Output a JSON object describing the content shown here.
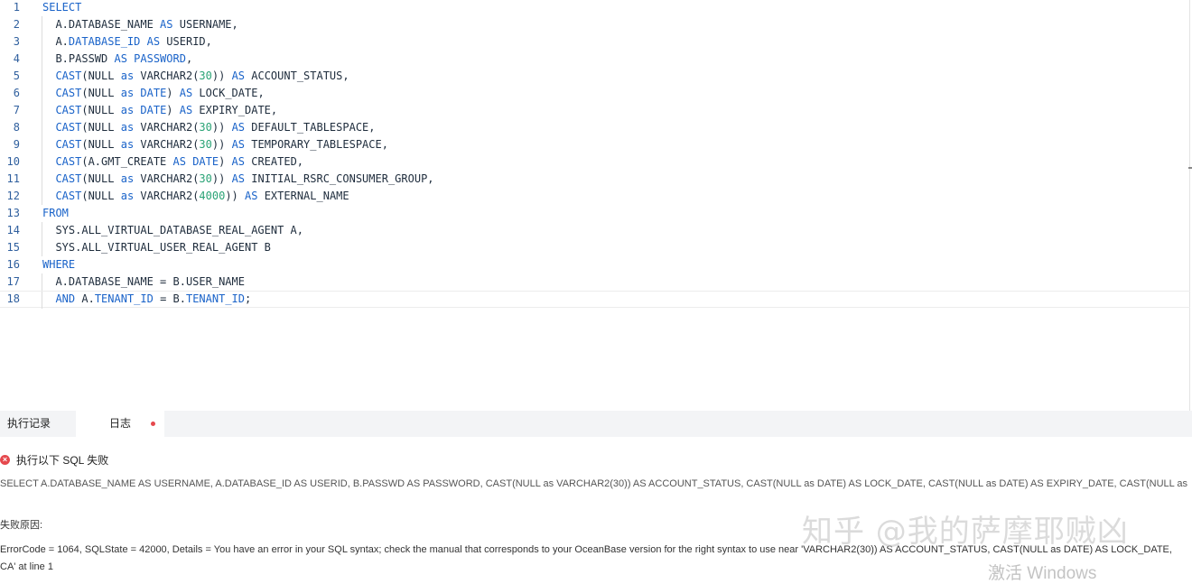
{
  "editor": {
    "lines": [
      [
        {
          "t": "SELECT",
          "c": "kw"
        }
      ],
      [
        {
          "t": "  A.DATABASE_NAME ",
          "c": "plain"
        },
        {
          "t": "AS",
          "c": "kw"
        },
        {
          "t": " USERNAME,",
          "c": "plain"
        }
      ],
      [
        {
          "t": "  A.",
          "c": "plain"
        },
        {
          "t": "DATABASE_ID",
          "c": "kw"
        },
        {
          "t": " ",
          "c": "plain"
        },
        {
          "t": "AS",
          "c": "kw"
        },
        {
          "t": " USERID,",
          "c": "plain"
        }
      ],
      [
        {
          "t": "  B.PASSWD ",
          "c": "plain"
        },
        {
          "t": "AS PASSWORD",
          "c": "kw"
        },
        {
          "t": ",",
          "c": "plain"
        }
      ],
      [
        {
          "t": "  ",
          "c": "plain"
        },
        {
          "t": "CAST",
          "c": "kw"
        },
        {
          "t": "(NULL ",
          "c": "plain"
        },
        {
          "t": "as",
          "c": "kw"
        },
        {
          "t": " VARCHAR2(",
          "c": "plain"
        },
        {
          "t": "30",
          "c": "num"
        },
        {
          "t": ")) ",
          "c": "plain"
        },
        {
          "t": "AS",
          "c": "kw"
        },
        {
          "t": " ACCOUNT_STATUS,",
          "c": "plain"
        }
      ],
      [
        {
          "t": "  ",
          "c": "plain"
        },
        {
          "t": "CAST",
          "c": "kw"
        },
        {
          "t": "(NULL ",
          "c": "plain"
        },
        {
          "t": "as DATE",
          "c": "kw"
        },
        {
          "t": ") ",
          "c": "plain"
        },
        {
          "t": "AS",
          "c": "kw"
        },
        {
          "t": " LOCK_DATE,",
          "c": "plain"
        }
      ],
      [
        {
          "t": "  ",
          "c": "plain"
        },
        {
          "t": "CAST",
          "c": "kw"
        },
        {
          "t": "(NULL ",
          "c": "plain"
        },
        {
          "t": "as DATE",
          "c": "kw"
        },
        {
          "t": ") ",
          "c": "plain"
        },
        {
          "t": "AS",
          "c": "kw"
        },
        {
          "t": " EXPIRY_DATE,",
          "c": "plain"
        }
      ],
      [
        {
          "t": "  ",
          "c": "plain"
        },
        {
          "t": "CAST",
          "c": "kw"
        },
        {
          "t": "(NULL ",
          "c": "plain"
        },
        {
          "t": "as",
          "c": "kw"
        },
        {
          "t": " VARCHAR2(",
          "c": "plain"
        },
        {
          "t": "30",
          "c": "num"
        },
        {
          "t": ")) ",
          "c": "plain"
        },
        {
          "t": "AS",
          "c": "kw"
        },
        {
          "t": " DEFAULT_TABLESPACE,",
          "c": "plain"
        }
      ],
      [
        {
          "t": "  ",
          "c": "plain"
        },
        {
          "t": "CAST",
          "c": "kw"
        },
        {
          "t": "(NULL ",
          "c": "plain"
        },
        {
          "t": "as",
          "c": "kw"
        },
        {
          "t": " VARCHAR2(",
          "c": "plain"
        },
        {
          "t": "30",
          "c": "num"
        },
        {
          "t": ")) ",
          "c": "plain"
        },
        {
          "t": "AS",
          "c": "kw"
        },
        {
          "t": " TEMPORARY_TABLESPACE,",
          "c": "plain"
        }
      ],
      [
        {
          "t": "  ",
          "c": "plain"
        },
        {
          "t": "CAST",
          "c": "kw"
        },
        {
          "t": "(A.GMT_CREATE ",
          "c": "plain"
        },
        {
          "t": "AS DATE",
          "c": "kw"
        },
        {
          "t": ") ",
          "c": "plain"
        },
        {
          "t": "AS",
          "c": "kw"
        },
        {
          "t": " CREATED,",
          "c": "plain"
        }
      ],
      [
        {
          "t": "  ",
          "c": "plain"
        },
        {
          "t": "CAST",
          "c": "kw"
        },
        {
          "t": "(NULL ",
          "c": "plain"
        },
        {
          "t": "as",
          "c": "kw"
        },
        {
          "t": " VARCHAR2(",
          "c": "plain"
        },
        {
          "t": "30",
          "c": "num"
        },
        {
          "t": ")) ",
          "c": "plain"
        },
        {
          "t": "AS",
          "c": "kw"
        },
        {
          "t": " INITIAL_RSRC_CONSUMER_GROUP,",
          "c": "plain"
        }
      ],
      [
        {
          "t": "  ",
          "c": "plain"
        },
        {
          "t": "CAST",
          "c": "kw"
        },
        {
          "t": "(NULL ",
          "c": "plain"
        },
        {
          "t": "as",
          "c": "kw"
        },
        {
          "t": " VARCHAR2(",
          "c": "plain"
        },
        {
          "t": "4000",
          "c": "num"
        },
        {
          "t": ")) ",
          "c": "plain"
        },
        {
          "t": "AS",
          "c": "kw"
        },
        {
          "t": " EXTERNAL_NAME",
          "c": "plain"
        }
      ],
      [
        {
          "t": "FROM",
          "c": "kw"
        }
      ],
      [
        {
          "t": "  SYS.ALL_VIRTUAL_DATABASE_REAL_AGENT A,",
          "c": "plain"
        }
      ],
      [
        {
          "t": "  SYS.ALL_VIRTUAL_USER_REAL_AGENT B",
          "c": "plain"
        }
      ],
      [
        {
          "t": "WHERE",
          "c": "kw"
        }
      ],
      [
        {
          "t": "  A.DATABASE_NAME = B.USER_NAME",
          "c": "plain"
        }
      ],
      [
        {
          "t": "  ",
          "c": "plain"
        },
        {
          "t": "AND",
          "c": "kw"
        },
        {
          "t": " A.",
          "c": "plain"
        },
        {
          "t": "TENANT_ID",
          "c": "kw"
        },
        {
          "t": " = B.",
          "c": "plain"
        },
        {
          "t": "TENANT_ID",
          "c": "kw"
        },
        {
          "t": ";",
          "c": "plain"
        }
      ]
    ],
    "line_numbers": [
      "1",
      "2",
      "3",
      "4",
      "5",
      "6",
      "7",
      "8",
      "9",
      "10",
      "11",
      "12",
      "13",
      "14",
      "15",
      "16",
      "17",
      "18"
    ],
    "active_line": 18,
    "colors": {
      "keyword": "#1a63c9",
      "number": "#2aa376",
      "text": "#1f2d3d"
    }
  },
  "tabs": [
    {
      "label": "执行记录"
    },
    {
      "label": "日志"
    }
  ],
  "log": {
    "error_title": "执行以下 SQL 失败",
    "sql": "SELECT A.DATABASE_NAME AS USERNAME, A.DATABASE_ID AS USERID, B.PASSWD AS PASSWORD, CAST(NULL as VARCHAR2(30)) AS ACCOUNT_STATUS, CAST(NULL as DATE) AS LOCK_DATE, CAST(NULL as DATE) AS EXPIRY_DATE, CAST(NULL as VA ...",
    "reason_label": "失败原因:",
    "details": "ErrorCode = 1064, SQLState = 42000, Details = You have an error in your SQL syntax; check the manual that corresponds to your OceanBase version for the right syntax to use near 'VARCHAR2(30)) AS ACCOUNT_STATUS, CAST(NULL as DATE) AS LOCK_DATE, CA' at line 1"
  },
  "watermark": "知乎 @我的萨摩耶贼凶",
  "windows_watermark": "激活 Windows"
}
